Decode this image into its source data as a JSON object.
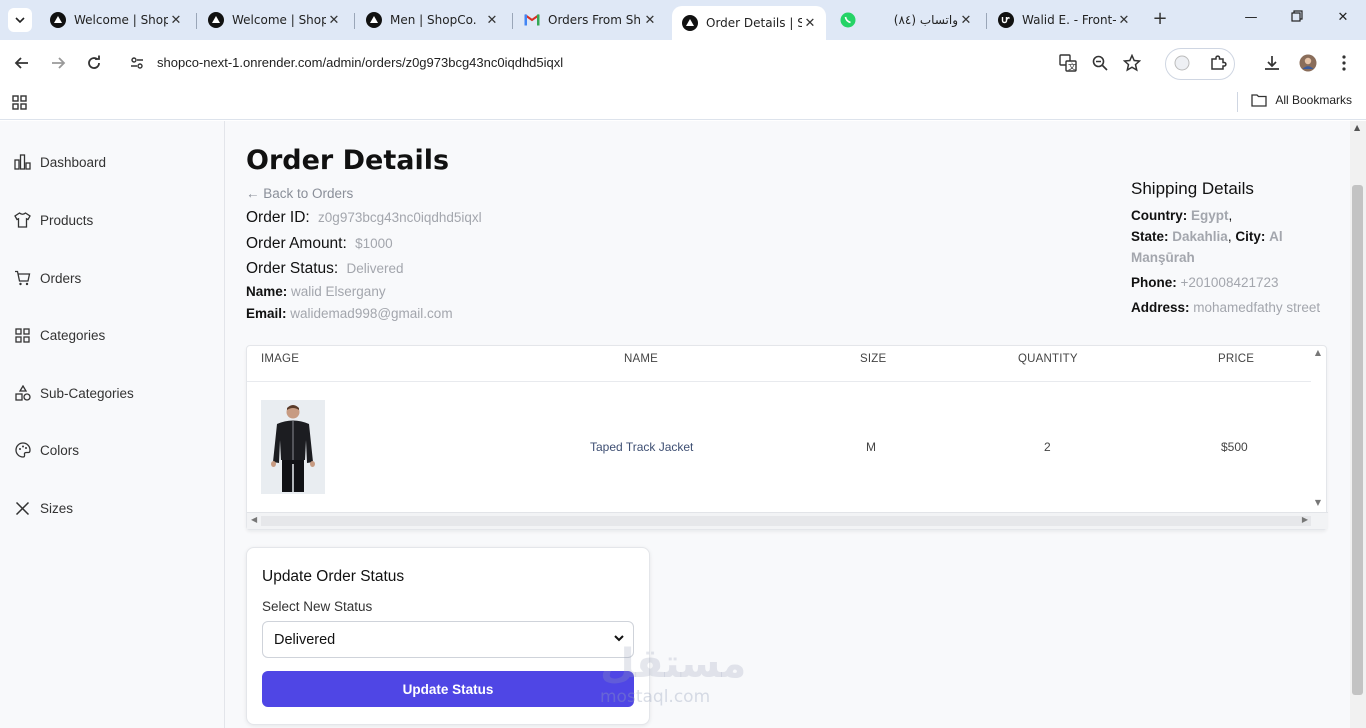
{
  "browser": {
    "tabs": [
      {
        "title": "Welcome | Shop",
        "icon": "triangle-logo-icon"
      },
      {
        "title": "Welcome | Shop",
        "icon": "triangle-logo-icon"
      },
      {
        "title": "Men | ShopCo.",
        "icon": "triangle-logo-icon"
      },
      {
        "title": "Orders From Sh",
        "icon": "gmail-icon"
      },
      {
        "title": "Order Details | S",
        "icon": "triangle-logo-icon",
        "active": true
      },
      {
        "title": "(٨٤) واتساب",
        "icon": "whatsapp-icon"
      },
      {
        "title": "Walid E. - Front-",
        "icon": "upwork-icon"
      }
    ],
    "url": "shopco-next-1.onrender.com/admin/orders/z0g973bcg43nc0iqdhd5iqxl",
    "bookmarks_label": "All Bookmarks"
  },
  "sidebar": {
    "items": [
      {
        "label": "Dashboard",
        "icon": "bar-chart-icon"
      },
      {
        "label": "Products",
        "icon": "shirt-icon"
      },
      {
        "label": "Orders",
        "icon": "cart-icon"
      },
      {
        "label": "Categories",
        "icon": "grid-icon"
      },
      {
        "label": "Sub-Categories",
        "icon": "shapes-icon"
      },
      {
        "label": "Colors",
        "icon": "palette-icon"
      },
      {
        "label": "Sizes",
        "icon": "x-icon"
      }
    ]
  },
  "order": {
    "title": "Order Details",
    "back_label": "Back to Orders",
    "id_label": "Order ID:",
    "id_value": "z0g973bcg43nc0iqdhd5iqxl",
    "amount_label": "Order Amount:",
    "amount_value": "$1000",
    "status_label": "Order Status:",
    "status_value": "Delivered",
    "name_label": "Name:",
    "name_value": "walid Elsergany",
    "email_label": "Email:",
    "email_value": "walidemad998@gmail.com"
  },
  "shipping": {
    "title": "Shipping Details",
    "country_label": "Country:",
    "country_value": "Egypt",
    "state_label": "State:",
    "state_value": "Dakahlia",
    "city_label": "City:",
    "city_value": "Al Manşūrah",
    "phone_label": "Phone:",
    "phone_value": "+201008421723",
    "address_label": "Address:",
    "address_value": "mohamedfathy street"
  },
  "table": {
    "headers": [
      "IMAGE",
      "NAME",
      "SIZE",
      "QUANTITY",
      "PRICE"
    ],
    "rows": [
      {
        "name": "Taped Track Jacket",
        "size": "M",
        "quantity": "2",
        "price": "$500"
      }
    ]
  },
  "status_form": {
    "title": "Update Order Status",
    "select_label": "Select New Status",
    "selected": "Delivered",
    "button_label": "Update Status",
    "accent": "#4f46e5"
  },
  "watermark": {
    "text": "مستقل",
    "subtext": "mostaql.com"
  }
}
